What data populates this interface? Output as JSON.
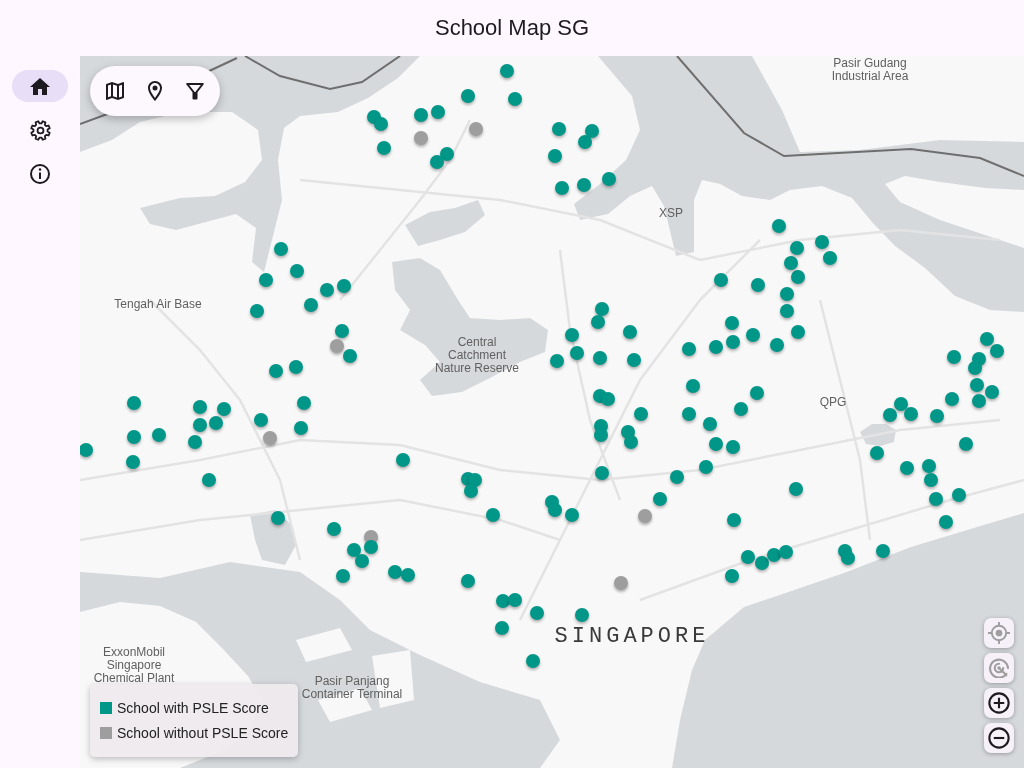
{
  "app_bar": {
    "title": "School Map SG"
  },
  "navigation_rail": {
    "items": [
      {
        "selected": true
      },
      {
        "selected": false
      },
      {
        "selected": false
      }
    ]
  },
  "map": {
    "place_labels": [
      {
        "text": "Pasir Gudang Industrial Area",
        "kind": "place"
      },
      {
        "text": "XSP",
        "kind": "place"
      },
      {
        "text": "Tengah Air Base",
        "kind": "place"
      },
      {
        "text": "Central Catchment Nature Reserve",
        "kind": "place"
      },
      {
        "text": "QPG",
        "kind": "place"
      },
      {
        "text": "SINGAPORE",
        "kind": "city"
      },
      {
        "text": "ExxonMobil Singapore Chemical Plant",
        "kind": "place"
      },
      {
        "text": "Pasir Panjang Container Terminal",
        "kind": "place"
      }
    ],
    "markers": [
      {
        "has_psle_score": true
      },
      {
        "has_psle_score": true
      },
      {
        "has_psle_score": true
      },
      {
        "has_psle_score": true
      },
      {
        "has_psle_score": true
      },
      {
        "has_psle_score": true
      },
      {
        "has_psle_score": true
      },
      {
        "has_psle_score": true
      },
      {
        "has_psle_score": false
      },
      {
        "has_psle_score": false
      },
      {
        "has_psle_score": true
      },
      {
        "has_psle_score": true
      },
      {
        "has_psle_score": true
      },
      {
        "has_psle_score": true
      },
      {
        "has_psle_score": true
      },
      {
        "has_psle_score": true
      },
      {
        "has_psle_score": true
      },
      {
        "has_psle_score": true
      },
      {
        "has_psle_score": true
      },
      {
        "has_psle_score": true
      },
      {
        "has_psle_score": true
      },
      {
        "has_psle_score": true
      },
      {
        "has_psle_score": true
      },
      {
        "has_psle_score": true
      },
      {
        "has_psle_score": true
      },
      {
        "has_psle_score": true
      },
      {
        "has_psle_score": true
      },
      {
        "has_psle_score": false
      },
      {
        "has_psle_score": true
      },
      {
        "has_psle_score": true
      },
      {
        "has_psle_score": true
      },
      {
        "has_psle_score": true
      },
      {
        "has_psle_score": true
      },
      {
        "has_psle_score": true
      },
      {
        "has_psle_score": true
      },
      {
        "has_psle_score": true
      },
      {
        "has_psle_score": true
      },
      {
        "has_psle_score": true
      },
      {
        "has_psle_score": true
      },
      {
        "has_psle_score": false
      },
      {
        "has_psle_score": true
      },
      {
        "has_psle_score": true
      },
      {
        "has_psle_score": true
      },
      {
        "has_psle_score": true
      },
      {
        "has_psle_score": true
      },
      {
        "has_psle_score": true
      },
      {
        "has_psle_score": true
      },
      {
        "has_psle_score": true
      },
      {
        "has_psle_score": true
      },
      {
        "has_psle_score": true
      },
      {
        "has_psle_score": true
      },
      {
        "has_psle_score": true
      },
      {
        "has_psle_score": true
      },
      {
        "has_psle_score": true
      },
      {
        "has_psle_score": true
      },
      {
        "has_psle_score": false
      },
      {
        "has_psle_score": true
      },
      {
        "has_psle_score": true
      },
      {
        "has_psle_score": true
      },
      {
        "has_psle_score": true
      },
      {
        "has_psle_score": true
      },
      {
        "has_psle_score": true
      },
      {
        "has_psle_score": true
      },
      {
        "has_psle_score": true
      },
      {
        "has_psle_score": true
      },
      {
        "has_psle_score": true
      },
      {
        "has_psle_score": true
      },
      {
        "has_psle_score": true
      },
      {
        "has_psle_score": true
      },
      {
        "has_psle_score": true
      },
      {
        "has_psle_score": false
      },
      {
        "has_psle_score": false
      },
      {
        "has_psle_score": true
      },
      {
        "has_psle_score": true
      },
      {
        "has_psle_score": true
      },
      {
        "has_psle_score": true
      },
      {
        "has_psle_score": true
      },
      {
        "has_psle_score": true
      },
      {
        "has_psle_score": true
      },
      {
        "has_psle_score": true
      },
      {
        "has_psle_score": true
      },
      {
        "has_psle_score": true
      },
      {
        "has_psle_score": true
      },
      {
        "has_psle_score": true
      },
      {
        "has_psle_score": true
      },
      {
        "has_psle_score": true
      },
      {
        "has_psle_score": true
      },
      {
        "has_psle_score": true
      },
      {
        "has_psle_score": true
      },
      {
        "has_psle_score": true
      },
      {
        "has_psle_score": true
      },
      {
        "has_psle_score": true
      },
      {
        "has_psle_score": true
      },
      {
        "has_psle_score": true
      },
      {
        "has_psle_score": true
      },
      {
        "has_psle_score": true
      },
      {
        "has_psle_score": true
      },
      {
        "has_psle_score": true
      },
      {
        "has_psle_score": true
      },
      {
        "has_psle_score": true
      },
      {
        "has_psle_score": true
      },
      {
        "has_psle_score": true
      },
      {
        "has_psle_score": true
      },
      {
        "has_psle_score": true
      },
      {
        "has_psle_score": true
      },
      {
        "has_psle_score": true
      },
      {
        "has_psle_score": true
      },
      {
        "has_psle_score": true
      },
      {
        "has_psle_score": true
      },
      {
        "has_psle_score": true
      },
      {
        "has_psle_score": true
      },
      {
        "has_psle_score": true
      },
      {
        "has_psle_score": true
      },
      {
        "has_psle_score": true
      },
      {
        "has_psle_score": true
      },
      {
        "has_psle_score": true
      },
      {
        "has_psle_score": true
      },
      {
        "has_psle_score": true
      },
      {
        "has_psle_score": true
      },
      {
        "has_psle_score": true
      },
      {
        "has_psle_score": true
      },
      {
        "has_psle_score": true
      },
      {
        "has_psle_score": true
      },
      {
        "has_psle_score": true
      },
      {
        "has_psle_score": true
      },
      {
        "has_psle_score": true
      },
      {
        "has_psle_score": true
      },
      {
        "has_psle_score": true
      },
      {
        "has_psle_score": true
      },
      {
        "has_psle_score": true
      },
      {
        "has_psle_score": true
      },
      {
        "has_psle_score": true
      },
      {
        "has_psle_score": true
      },
      {
        "has_psle_score": true
      },
      {
        "has_psle_score": true
      },
      {
        "has_psle_score": true
      },
      {
        "has_psle_score": true
      },
      {
        "has_psle_score": true
      },
      {
        "has_psle_score": true
      },
      {
        "has_psle_score": true
      },
      {
        "has_psle_score": true
      },
      {
        "has_psle_score": true
      },
      {
        "has_psle_score": true
      },
      {
        "has_psle_score": true
      },
      {
        "has_psle_score": true
      },
      {
        "has_psle_score": true
      }
    ],
    "legend": [
      {
        "label": "School with PSLE Score",
        "color": "#009688"
      },
      {
        "label": "School without PSLE Score",
        "color": "#9e9e9e"
      }
    ],
    "controls": [
      {
        "disabled": true
      },
      {
        "disabled": true
      },
      {
        "disabled": false
      },
      {
        "disabled": false
      }
    ]
  }
}
